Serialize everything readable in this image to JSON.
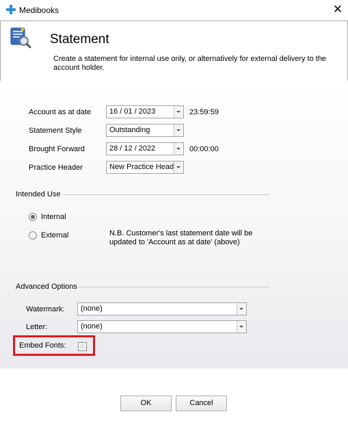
{
  "window": {
    "title": "Medibooks",
    "close_glyph": "✕"
  },
  "header": {
    "title": "Statement",
    "description": "Create a statement for internal use only, or alternatively for external delivery to the account holder."
  },
  "form": {
    "account_as_at": {
      "label": "Account as at date",
      "value": "16 / 01 / 2023",
      "time": "23:59:59"
    },
    "statement_style": {
      "label": "Statement Style",
      "value": "Outstanding"
    },
    "brought_forward": {
      "label": "Brought Forward",
      "value": "28 / 12 / 2022",
      "time": "00:00:00"
    },
    "practice_header": {
      "label": "Practice Header",
      "value": "New Practice Head"
    }
  },
  "intended_use": {
    "title": "Intended Use",
    "internal_label": "Internal",
    "external_label": "External",
    "selected": "Internal",
    "note": "N.B. Customer's last statement date will be updated to 'Account as at date' (above)"
  },
  "advanced": {
    "title": "Advanced Options",
    "watermark": {
      "label": "Watermark:",
      "value": "(none)"
    },
    "letter": {
      "label": "Letter:",
      "value": "(none)"
    },
    "embed_fonts": {
      "label": "Embed Fonts:",
      "checked": false
    }
  },
  "buttons": {
    "ok": "OK",
    "cancel": "Cancel"
  },
  "colors": {
    "highlight_box": "#e0191f",
    "app_icon": "#2a8fd6"
  }
}
